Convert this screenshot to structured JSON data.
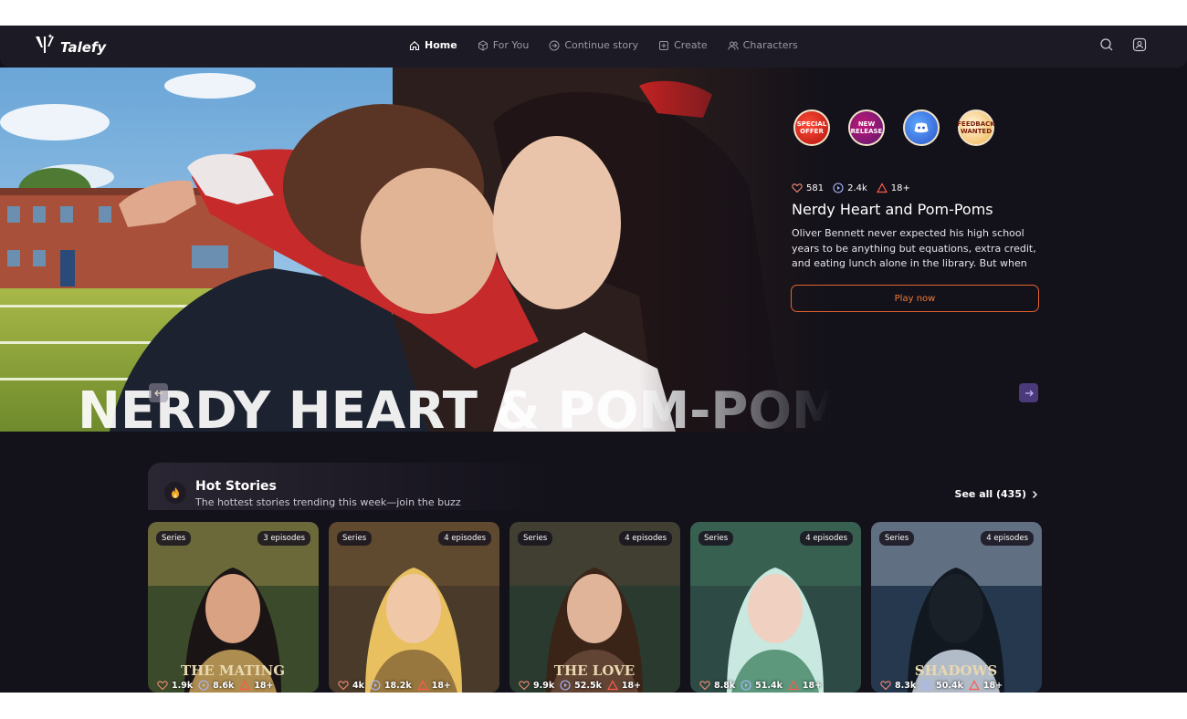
{
  "nav": {
    "logo": "Talefy",
    "links": [
      {
        "label": "Home",
        "active": true
      },
      {
        "label": "For You"
      },
      {
        "label": "Continue story"
      },
      {
        "label": "Create"
      },
      {
        "label": "Characters"
      }
    ]
  },
  "hero": {
    "title": "Nerdy Heart and Pom-Poms",
    "art_title": "NERDY HEART & POM-POMS",
    "likes": "581",
    "plays": "2.4k",
    "rating": "18+",
    "description": "Oliver Bennett never expected his high school years to be anything but equations, extra credit, and eating lunch alone in the library. But when he's assigned to...",
    "play_label": "Play now",
    "badges": [
      {
        "label": "SPECIAL OFFER"
      },
      {
        "label": "NEW RELEASE"
      },
      {
        "label": ""
      },
      {
        "label": "FEEDBACK WANTED"
      }
    ]
  },
  "section": {
    "title": "Hot Stories",
    "subtitle": "The hottest stories trending this week—join the buzz",
    "see_all": "See all (435)"
  },
  "cards": [
    {
      "tag": "Series",
      "episodes": "3 episodes",
      "likes": "1.9k",
      "plays": "8.6k",
      "rating": "18+",
      "art_text": "THE MATING",
      "colors": {
        "bg": "#3a4a2a",
        "accent": "#c9a25a",
        "hair": "#1a1414",
        "skin": "#d9a282"
      }
    },
    {
      "tag": "Series",
      "episodes": "4 episodes",
      "likes": "4k",
      "plays": "18.2k",
      "rating": "18+",
      "art_text": "",
      "colors": {
        "bg": "#4a3a2a",
        "accent": "#8a6a3a",
        "hair": "#e8c060",
        "skin": "#f0c8a8"
      }
    },
    {
      "tag": "Series",
      "episodes": "4 episodes",
      "likes": "9.9k",
      "plays": "52.5k",
      "rating": "18+",
      "art_text": "THE LOVE",
      "colors": {
        "bg": "#2a3a2e",
        "accent": "#6a4a3a",
        "hair": "#3a2418",
        "skin": "#e0b498"
      }
    },
    {
      "tag": "Series",
      "episodes": "4 episodes",
      "likes": "8.8k",
      "plays": "51.4k",
      "rating": "18+",
      "art_text": "",
      "colors": {
        "bg": "#2e4a44",
        "accent": "#4a8a6a",
        "hair": "#c8e8e0",
        "skin": "#f0d0c0"
      }
    },
    {
      "tag": "Series",
      "episodes": "4 episodes",
      "likes": "8.3k",
      "plays": "50.4k",
      "rating": "18+",
      "art_text": "SHADOWS",
      "colors": {
        "bg": "#26384e",
        "accent": "#cfd8e6",
        "hair": "#111820",
        "skin": "#1a2028"
      }
    }
  ],
  "colors": {
    "background": "#13111a",
    "nav": "#1c1a24",
    "accent": "#e5622f",
    "arrow": "#4a3a7a"
  }
}
